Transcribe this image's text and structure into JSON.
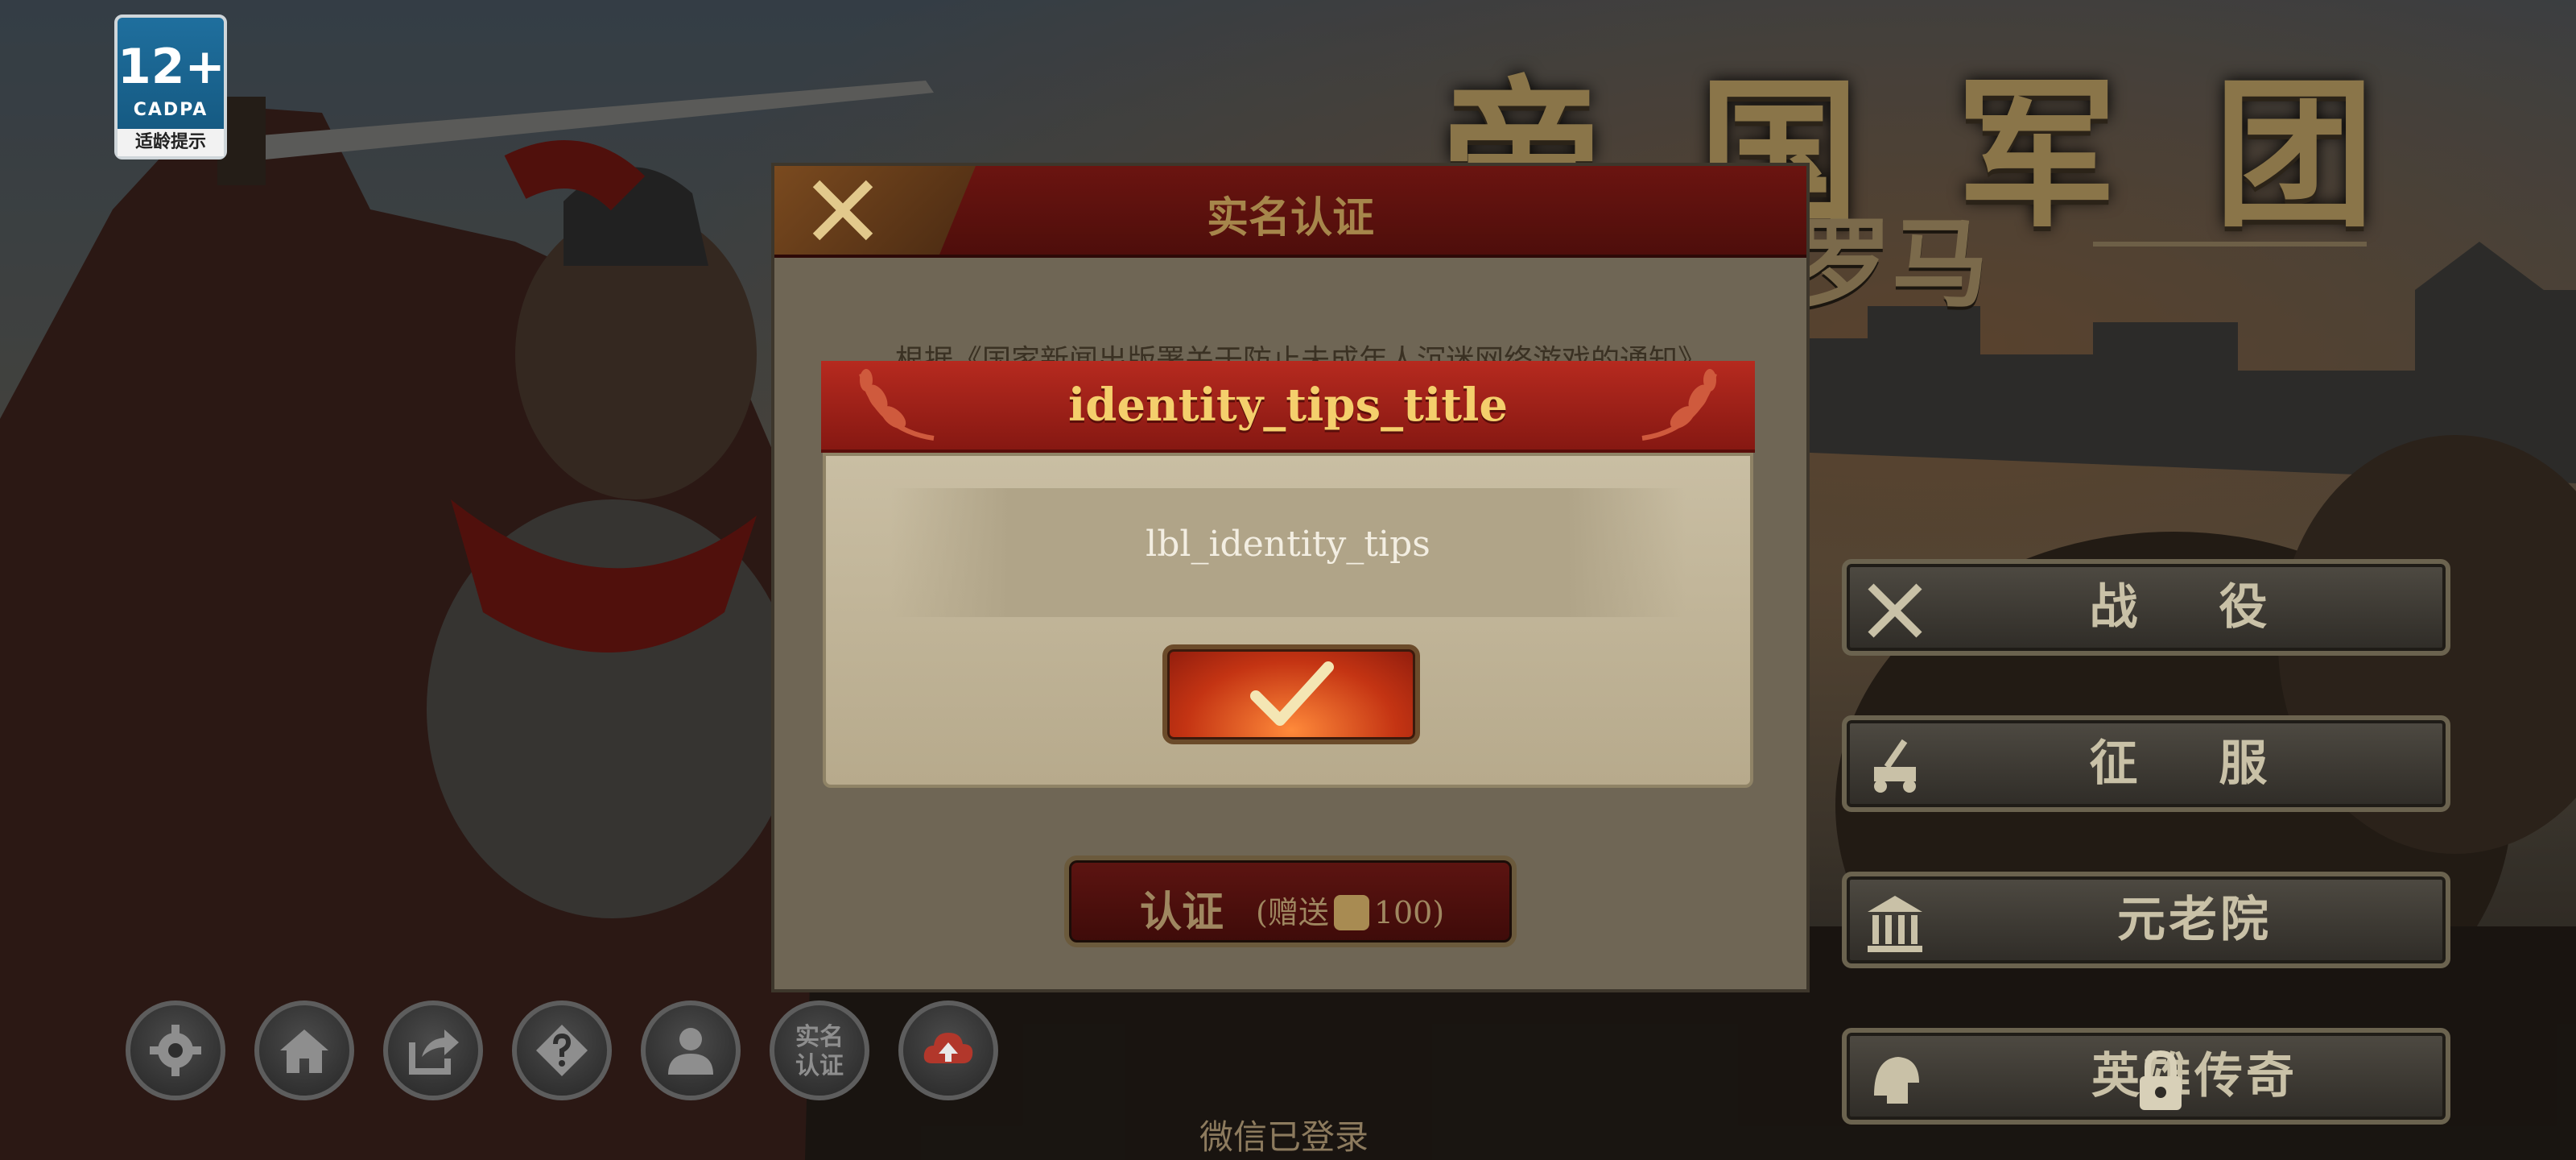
{
  "age_badge": {
    "rating": "12+",
    "org": "CADPA",
    "tip": "适龄提示"
  },
  "game": {
    "title": "帝国军团",
    "subtitle": "罗马"
  },
  "side_menu": [
    {
      "label": "战 役",
      "icon": "crossed-swords-icon"
    },
    {
      "label": "征 服",
      "icon": "catapult-icon"
    },
    {
      "label": "元老院",
      "icon": "temple-icon"
    },
    {
      "label": "英雄传奇",
      "icon": "helmet-icon",
      "locked": true
    }
  ],
  "bottom_buttons": [
    {
      "name": "settings",
      "icon": "gear-icon"
    },
    {
      "name": "home",
      "icon": "home-icon"
    },
    {
      "name": "share",
      "icon": "share-icon"
    },
    {
      "name": "help",
      "icon": "help-icon"
    },
    {
      "name": "account",
      "icon": "user-icon"
    },
    {
      "name": "real-name",
      "text": "实名\n认证"
    },
    {
      "name": "cloud",
      "icon": "cloud-upload-icon"
    }
  ],
  "status": {
    "wechat": "微信已登录"
  },
  "realname_dialog": {
    "title": "实名认证",
    "text": "根据《国家新闻出版署关于防止未成年人沉迷网络游戏的通知》",
    "certify_label": "认证",
    "gift_prefix": "(赠送",
    "gift_amount": "100)"
  },
  "tips_popup": {
    "title": "identity_tips_title",
    "message": "lbl_identity_tips"
  },
  "colors": {
    "popup_header": "#b62a1f",
    "popup_title": "#f4cf6c",
    "popup_body": "#c9bea3",
    "confirm_button": "#c43413"
  }
}
